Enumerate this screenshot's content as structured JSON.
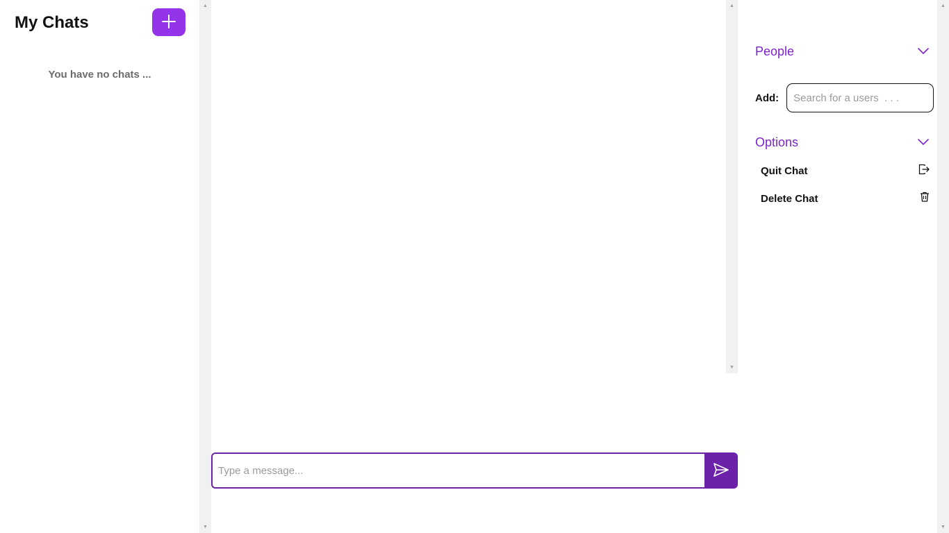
{
  "sidebar": {
    "title": "My Chats",
    "new_chat_icon": "plus-icon",
    "empty_text": "You have no chats ..."
  },
  "composer": {
    "placeholder": "Type a message...",
    "value": "",
    "send_icon": "send-icon"
  },
  "right_panel": {
    "people": {
      "title": "People",
      "chevron_icon": "chevron-down-icon",
      "add_label": "Add:",
      "search_placeholder": "Search for a users  . . ."
    },
    "options": {
      "title": "Options",
      "chevron_icon": "chevron-down-icon",
      "items": [
        {
          "label": "Quit Chat",
          "icon": "exit-icon"
        },
        {
          "label": "Delete Chat",
          "icon": "trash-icon"
        }
      ]
    }
  },
  "colors": {
    "accent": "#9333ea",
    "accent_dark": "#6b21a8",
    "accent_text": "#7e22ce",
    "muted_text": "#6b6b6b",
    "scrollbar": "#f1f1f1"
  }
}
